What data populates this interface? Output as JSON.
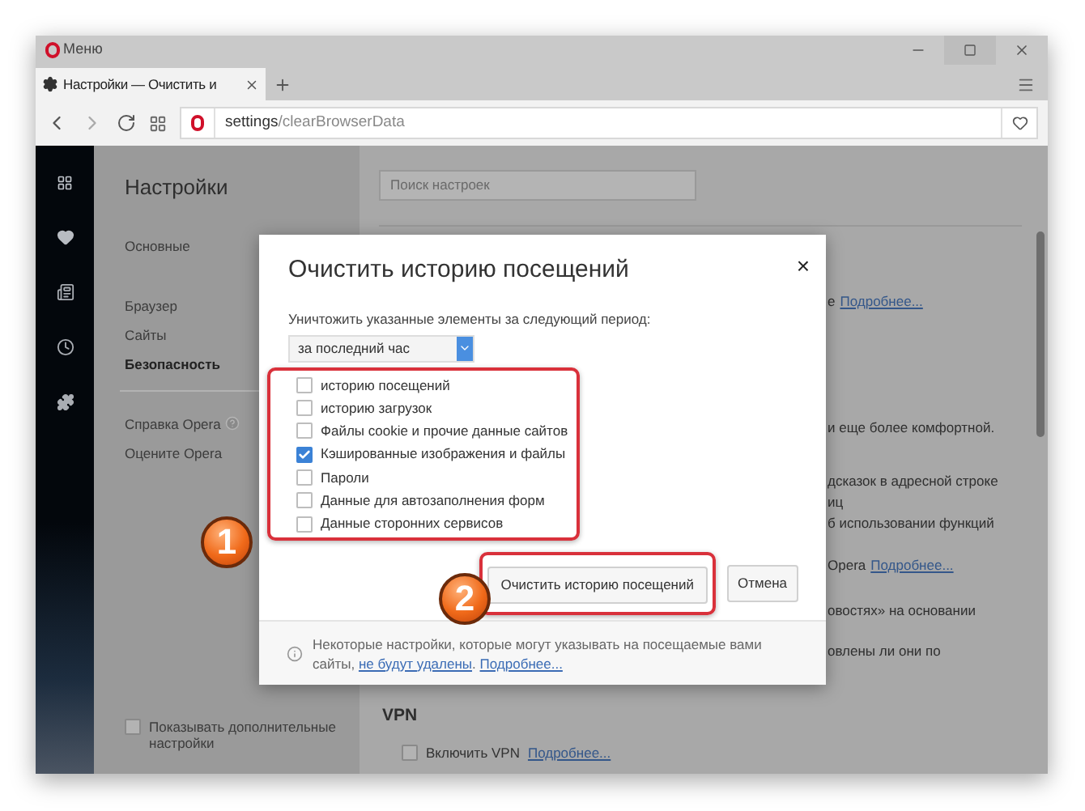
{
  "window": {
    "menu_label": "Меню"
  },
  "tab": {
    "title": "Настройки — Очистить и"
  },
  "address_bar": {
    "scheme": "settings",
    "path": "/clearBrowserData"
  },
  "settings_nav": {
    "title": "Настройки",
    "items": [
      {
        "label": "Основные",
        "selected": false
      },
      {
        "label": "Браузер",
        "selected": false
      },
      {
        "label": "Сайты",
        "selected": false
      },
      {
        "label": "Безопасность",
        "selected": true
      }
    ],
    "links": [
      "Справка Opera",
      "Оцените Opera"
    ],
    "advanced": {
      "label": "Показывать дополнительные настройки",
      "checked": false
    }
  },
  "search": {
    "placeholder": "Поиск настроек"
  },
  "background_lines": [
    {
      "text": "е",
      "link": "Подробнее..."
    },
    {
      "text": "и еще более комфортной."
    },
    {
      "text": "дсказок в адресной строке"
    },
    {
      "text": "иц"
    },
    {
      "text": "б использовании функций"
    },
    {
      "text": "Opera",
      "link": "Подробнее..."
    },
    {
      "text": "овостях» на основании"
    },
    {
      "text": "овлены ли они по"
    }
  ],
  "vpn": {
    "heading": "VPN",
    "label": "Включить VPN",
    "checked": false,
    "link": "Подробнее..."
  },
  "dialog": {
    "title": "Очистить историю посещений",
    "close": "×",
    "period_label": "Уничтожить указанные элементы за следующий период:",
    "period_value": "за последний час",
    "items": [
      {
        "label": "историю посещений",
        "checked": false
      },
      {
        "label": "историю загрузок",
        "checked": false
      },
      {
        "label": "Файлы cookie и прочие данные сайтов",
        "checked": false
      },
      {
        "label": "Кэшированные изображения и файлы",
        "checked": true
      },
      {
        "label": "Пароли",
        "checked": false
      },
      {
        "label": "Данные для автозаполнения форм",
        "checked": false
      },
      {
        "label": "Данные сторонних сервисов",
        "checked": false
      }
    ],
    "buttons": [
      "Очистить историю посещений",
      "Отмена"
    ],
    "footer": {
      "text": "Некоторые настройки, которые могут указывать на посещаемые вами сайты,",
      "link": "не будут удалены",
      "link_suffix": ".",
      "more_link": "Подробнее..."
    }
  },
  "annotations": [
    {
      "number": "1"
    },
    {
      "number": "2"
    }
  ]
}
